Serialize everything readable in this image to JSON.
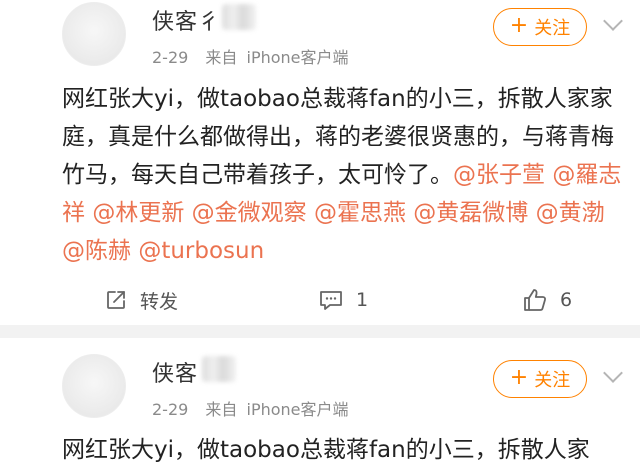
{
  "posts": [
    {
      "username": "侠客彳",
      "date": "2-29",
      "source_prefix": "来自",
      "source_device": "iPhone客户端",
      "follow_label": "关注",
      "content_parts": [
        {
          "text": "网红张大yi，做taobao总裁蒋fan的小三，拆散人家家庭，真是什么都做得出，蒋的老婆很贤惠的，与蒋青梅竹马，每天自己带着孩子，太可怜了。"
        },
        {
          "text": "@张子萱",
          "mention": true
        },
        {
          "text": " "
        },
        {
          "text": "@羅志祥",
          "mention": true
        },
        {
          "text": " "
        },
        {
          "text": "@林更新",
          "mention": true
        },
        {
          "text": " "
        },
        {
          "text": "@金微观察",
          "mention": true
        },
        {
          "text": " "
        },
        {
          "text": "@霍思燕",
          "mention": true
        },
        {
          "text": " "
        },
        {
          "text": "@黄磊微博",
          "mention": true
        },
        {
          "text": " "
        },
        {
          "text": "@黄渤",
          "mention": true
        },
        {
          "text": " "
        },
        {
          "text": "@陈赫",
          "mention": true
        },
        {
          "text": " "
        },
        {
          "text": "@turbosun",
          "mention": true
        }
      ],
      "actions": {
        "repost_label": "转发",
        "comment_count": "1",
        "like_count": "6"
      }
    },
    {
      "username": "侠客",
      "date": "2-29",
      "source_prefix": "来自",
      "source_device": "iPhone客户端",
      "follow_label": "关注",
      "content_text": "网红张大yi，做taobao总裁蒋fan的小三，拆散人家"
    }
  ],
  "colors": {
    "accent": "#ff8200",
    "mention": "#eb7350",
    "meta": "#8a8a8a"
  },
  "icons": [
    "repost-icon",
    "comment-icon",
    "like-icon",
    "chevron-down-icon",
    "plus-icon"
  ]
}
